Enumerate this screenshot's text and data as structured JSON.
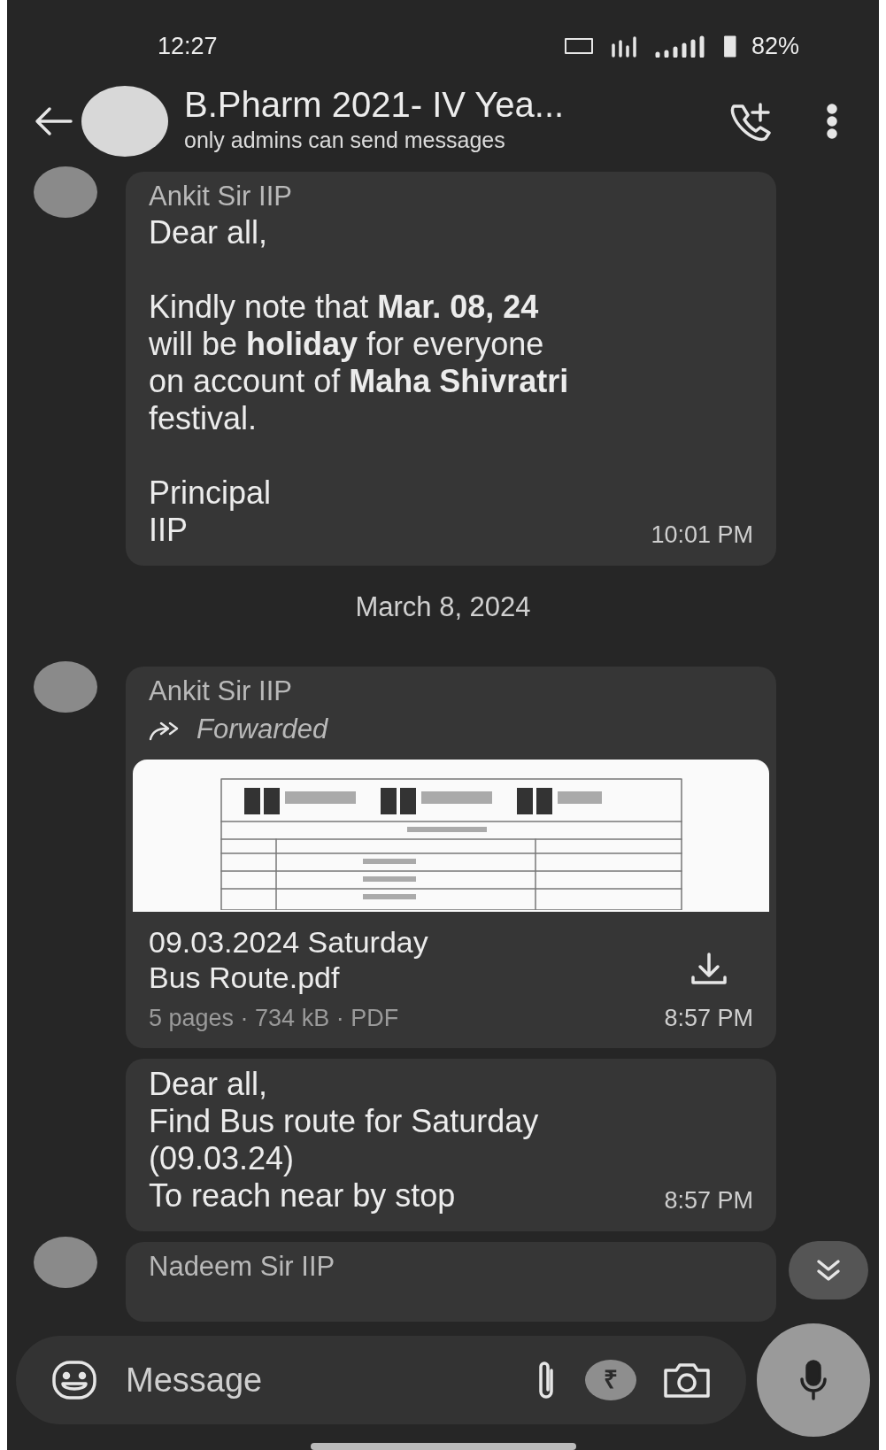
{
  "status_bar": {
    "time": "12:27",
    "battery": "82%"
  },
  "header": {
    "title": "B.Pharm 2021- IV Yea...",
    "subtitle": "only admins can send messages"
  },
  "messages": [
    {
      "kind": "text",
      "sender": "Ankit Sir IIP",
      "paragraphs": [
        "Dear all,",
        "Kindly note that **Mar. 08, 24**\nwill be **holiday** for everyone\non account of **Maha Shivratri**\nfestival.",
        "Principal\nIIP"
      ],
      "time": "10:01 PM"
    },
    {
      "kind": "date",
      "text": "March 8, 2024"
    },
    {
      "kind": "document",
      "sender": "Ankit Sir IIP",
      "forwarded_label": "Forwarded",
      "file_name": "09.03.2024 Saturday\nBus Route.pdf",
      "meta": "5 pages · 734 kB · PDF",
      "time": "8:57 PM"
    },
    {
      "kind": "text",
      "paragraphs": [
        "Dear all,\nFind Bus route for Saturday\n(09.03.24)\nTo reach near by stop"
      ],
      "time": "8:57 PM"
    },
    {
      "kind": "text",
      "sender": "Nadeem Sir IIP"
    }
  ],
  "composer": {
    "placeholder": "Message",
    "payment_glyph": "₹"
  }
}
